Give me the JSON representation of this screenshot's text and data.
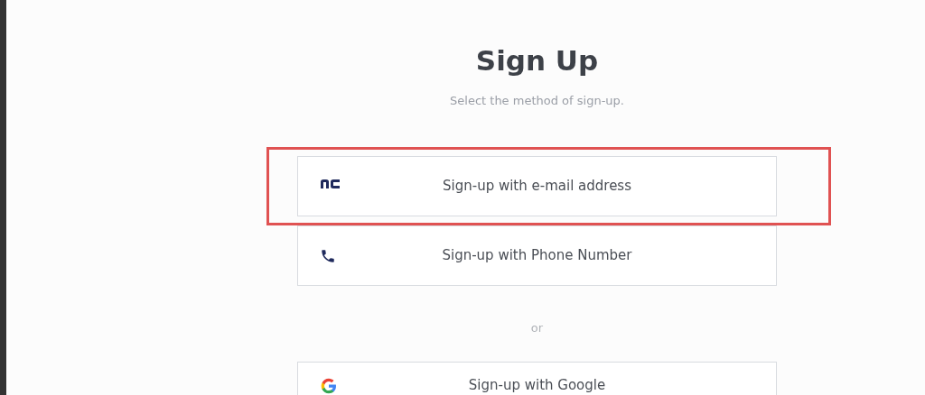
{
  "title": "Sign Up",
  "subtitle": "Select the method of sign-up.",
  "methods": [
    {
      "kind": "nc",
      "label": "Sign-up with e-mail address",
      "highlighted": true
    },
    {
      "kind": "phone",
      "label": "Sign-up with Phone Number",
      "highlighted": false
    }
  ],
  "separator": "or",
  "social": [
    {
      "kind": "google",
      "label": "Sign-up with Google",
      "highlighted": false
    }
  ]
}
